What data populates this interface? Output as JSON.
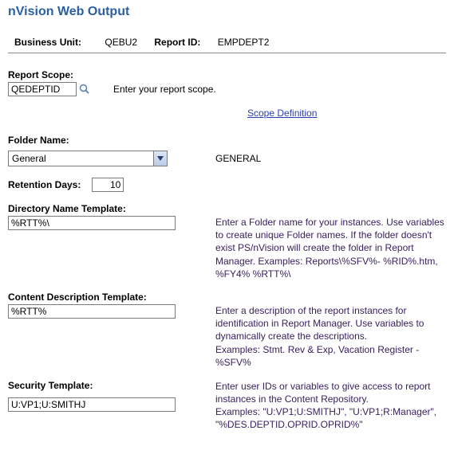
{
  "title": "nVision Web Output",
  "header": {
    "business_unit_label": "Business Unit:",
    "business_unit_value": "QEBU2",
    "report_id_label": "Report ID:",
    "report_id_value": "EMPDEPT2"
  },
  "scope": {
    "label": "Report Scope:",
    "value": "QEDEPTID",
    "hint": "Enter your report scope.",
    "definition_link": "Scope Definition"
  },
  "folder": {
    "label": "Folder Name:",
    "selected": "General",
    "code": "GENERAL"
  },
  "retention": {
    "label": "Retention Days:",
    "value": "10"
  },
  "dir_template": {
    "label": "Directory Name Template:",
    "value": "%RTT%\\",
    "help": "Enter a Folder name for your instances. Use variables to create unique Folder names. If the folder doesn't exist PS/nVision will create the folder in Report Manager. Examples: Reports\\%SFV%- %RID%.htm, %FY4% %RTT%\\"
  },
  "content_template": {
    "label": "Content Description Template:",
    "value": "%RTT%",
    "help": "Enter a description of the report instances for identification in Report Manager. Use variables to dynamically create the descriptions.\nExamples: Stmt. Rev & Exp, Vacation Register - %SFV%"
  },
  "security_template": {
    "label": "Security Template:",
    "value": "U:VP1;U:SMITHJ",
    "help": "Enter user IDs or variables to give access to report instances in the Content Repository.\nExamples: \"U:VP1;U:SMITHJ\", \"U:VP1;R:Manager\", \"%DES.DEPTID.OPRID.OPRID%\""
  }
}
